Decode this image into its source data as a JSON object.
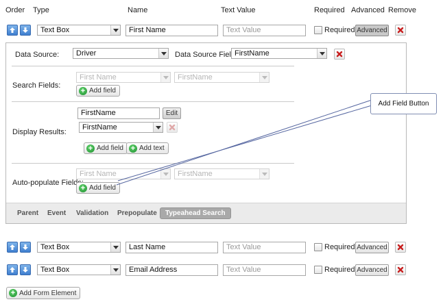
{
  "headers": {
    "order": "Order",
    "type": "Type",
    "name": "Name",
    "text_value": "Text Value",
    "required": "Required",
    "advanced": "Advanced",
    "remove": "Remove"
  },
  "rows": [
    {
      "type": "Text Box",
      "name": "First Name",
      "text_value_placeholder": "Text Value",
      "required_label": "Required",
      "advanced_label": "Advanced"
    },
    {
      "type": "Text Box",
      "name": "Last Name",
      "text_value_placeholder": "Text Value",
      "required_label": "Required",
      "advanced_label": "Advanced"
    },
    {
      "type": "Text Box",
      "name": "Email Address",
      "text_value_placeholder": "Text Value",
      "required_label": "Required",
      "advanced_label": "Advanced"
    }
  ],
  "panel": {
    "data_source_label": "Data Source:",
    "data_source_value": "Driver",
    "data_source_field_label": "Data Source Field:",
    "data_source_field_value": "FirstName",
    "search_fields_label": "Search Fields:",
    "search_field_1": "First Name",
    "search_field_2": "FirstName",
    "add_field": "Add field",
    "display_results_label": "Display Results:",
    "display_text_value": "FirstName",
    "edit_label": "Edit",
    "display_select_value": "FirstName",
    "add_text": "Add text",
    "auto_populate_label": "Auto-populate Fields:",
    "auto_field_1": "First Name",
    "auto_field_2": "FirstName"
  },
  "tabs": [
    "Parent",
    "Event",
    "Validation",
    "Prepopulate",
    "Typeahead Search"
  ],
  "active_tab": "Typeahead Search",
  "callout": "Add Field Button",
  "add_form_element": "Add Form Element",
  "colors": {
    "accent_blue": "#3f7fcf",
    "remove_red": "#c81e1e",
    "add_green": "#1f8f31",
    "active_tab": "#a9a9a9"
  }
}
